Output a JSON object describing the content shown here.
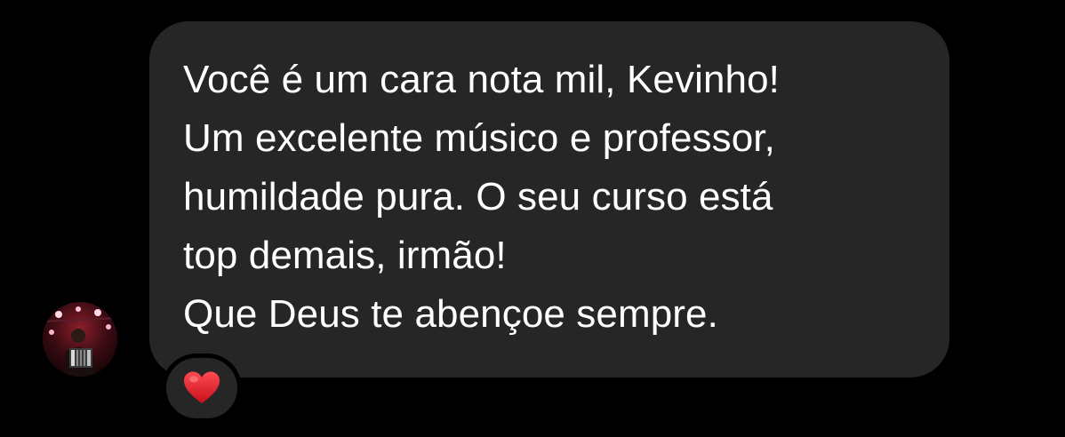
{
  "message": {
    "lines": [
      "Você é um cara nota mil, Kevinho!",
      "Um excelente músico e professor,",
      "humildade pura. O seu curso está",
      "top demais, irmão!",
      "Que Deus te abençoe sempre."
    ]
  },
  "reaction": {
    "icon": "red-heart-icon",
    "color": "#e0202a"
  },
  "avatar": {
    "icon": "profile-photo-accordion-player"
  },
  "colors": {
    "background": "#000000",
    "bubble": "#262626",
    "text": "#ffffff"
  }
}
